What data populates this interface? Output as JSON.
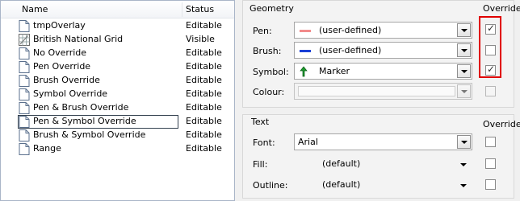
{
  "layers": {
    "columns": {
      "name": "Name",
      "status": "Status"
    },
    "rows": [
      {
        "name": "tmpOverlay",
        "status": "Editable"
      },
      {
        "name": "British National Grid",
        "status": "Visible"
      },
      {
        "name": "No Override",
        "status": "Editable"
      },
      {
        "name": "Pen Override",
        "status": "Editable"
      },
      {
        "name": "Brush Override",
        "status": "Editable"
      },
      {
        "name": "Symbol Override",
        "status": "Editable"
      },
      {
        "name": "Pen & Brush Override",
        "status": "Editable"
      },
      {
        "name": "Pen & Symbol Override",
        "status": "Editable"
      },
      {
        "name": "Brush & Symbol Override",
        "status": "Editable"
      },
      {
        "name": "Range",
        "status": "Editable"
      }
    ]
  },
  "geometry": {
    "title": "Geometry",
    "override_header": "Override",
    "pen": {
      "label": "Pen:",
      "value": "(user-defined)",
      "swatch": "#f28b8b",
      "override": true
    },
    "brush": {
      "label": "Brush:",
      "value": "(user-defined)",
      "swatch": "#1a3fd6",
      "override": false
    },
    "symbol": {
      "label": "Symbol:",
      "value": "Marker",
      "override": true
    },
    "colour": {
      "label": "Colour:",
      "value": "",
      "override": false
    }
  },
  "text": {
    "title": "Text",
    "override_header": "Override",
    "font": {
      "label": "Font:",
      "value": "Arial",
      "override": false
    },
    "fill": {
      "label": "Fill:",
      "value": "(default)",
      "override": false
    },
    "outline": {
      "label": "Outline:",
      "value": "(default)",
      "override": false
    }
  },
  "colors": {
    "highlight": "#e00000",
    "selection_border": "#34414f"
  }
}
